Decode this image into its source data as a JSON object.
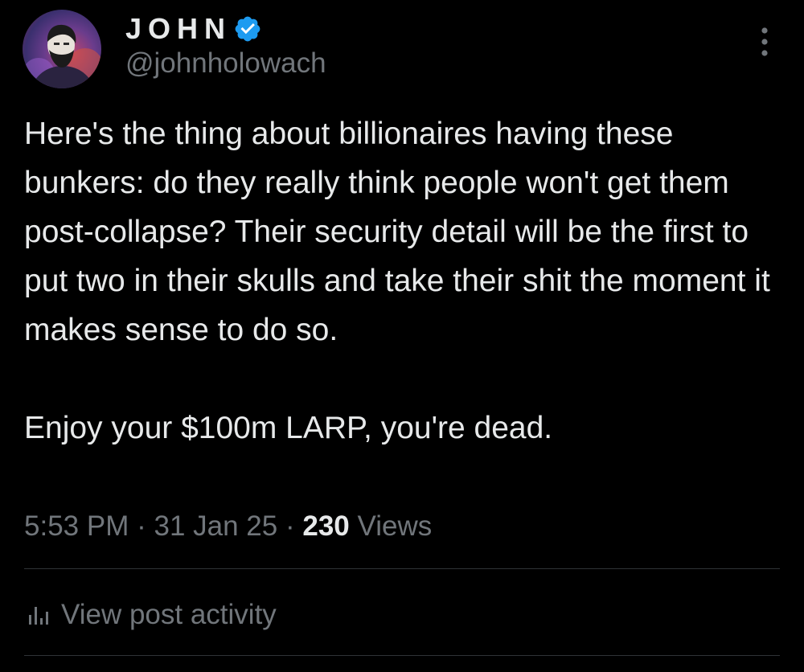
{
  "author": {
    "display_name": "JOHN",
    "handle": "@johnholowach",
    "verified": true,
    "avatar_icon": "avatar-portrait"
  },
  "post": {
    "paragraphs": [
      "Here's the thing about billionaires having these bunkers: do they really think people won't get them post-collapse? Their security detail will be the first to put two in their skulls and take their shit the moment it makes sense to do so.",
      "Enjoy your $100m LARP, you're dead."
    ]
  },
  "meta": {
    "time": "5:53 PM",
    "separator": "·",
    "date": "31 Jan 25",
    "views_count": "230",
    "views_label": "Views"
  },
  "actions": {
    "activity_label": "View post activity",
    "activity_icon": "bar-chart-icon",
    "more_icon": "more-vertical-icon"
  },
  "colors": {
    "background": "#000000",
    "text_primary": "#e7e9ea",
    "text_secondary": "#71767b",
    "verified_badge": "#1d9bf0",
    "divider": "#2f3336"
  }
}
